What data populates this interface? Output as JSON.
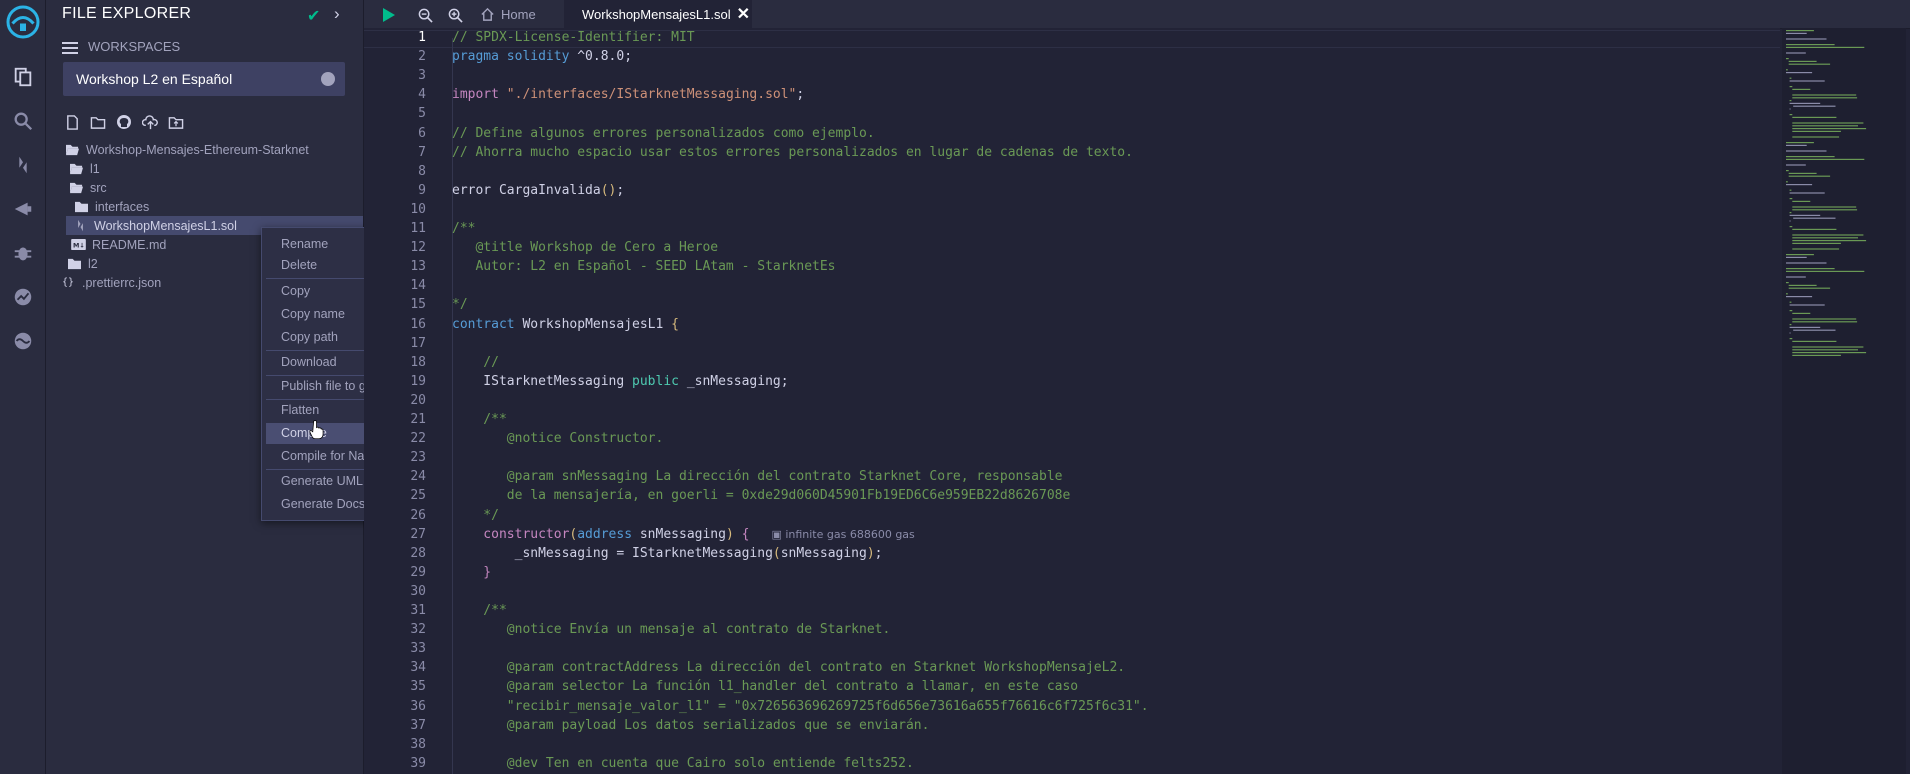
{
  "colors": {
    "accent": "#00bc8c",
    "sidebar_bg": "#2a2c3f",
    "editor_bg": "#222336",
    "menu_highlight": "#4a4e72"
  },
  "icon_bar": [
    "remix-logo-icon",
    "file-explorer-icon",
    "search-icon",
    "solidity-compiler-icon",
    "deploy-run-icon",
    "debugger-icon",
    "analytics-icon",
    "plugin-icon"
  ],
  "panel": {
    "title": "FILE EXPLORER",
    "workspaces_label": "WORKSPACES",
    "workspace_selected": "Workshop L2 en Español",
    "toolbar_icons": [
      "new-file-icon",
      "new-folder-icon",
      "github-icon",
      "upload-icon",
      "upload-folder-icon"
    ]
  },
  "tree": [
    {
      "label": "Workshop-Mensajes-Ethereum-Starknet",
      "icon": "folder-open-icon"
    },
    {
      "label": "l1",
      "icon": "folder-open-icon"
    },
    {
      "label": "src",
      "icon": "folder-open-icon"
    },
    {
      "label": "interfaces",
      "icon": "folder-icon"
    },
    {
      "label": "WorkshopMensajesL1.sol",
      "icon": "solidity-file-icon"
    },
    {
      "label": "README.md",
      "icon": "markdown-icon"
    },
    {
      "label": "l2",
      "icon": "folder-icon"
    },
    {
      "label": ".prettierrc.json",
      "icon": "json-icon"
    }
  ],
  "context_menu": {
    "items": [
      "Rename",
      "Delete",
      "Copy",
      "Copy name",
      "Copy path",
      "Download",
      "Publish file to gist",
      "Flatten",
      "Compile",
      "Compile for Nahmii",
      "Generate UML",
      "Generate Docs"
    ],
    "highlighted": "Compile"
  },
  "tabs": {
    "home": "Home",
    "active": "WorkshopMensajesL1.sol"
  },
  "editor": {
    "line_numbers": [
      "1",
      "2",
      "3",
      "4",
      "5",
      "6",
      "7",
      "8",
      "9",
      "10",
      "11",
      "12",
      "13",
      "14",
      "15",
      "16",
      "17",
      "18",
      "19",
      "20",
      "21",
      "22",
      "23",
      "24",
      "25",
      "26",
      "27",
      "28",
      "29",
      "30",
      "31",
      "32",
      "33",
      "34",
      "35",
      "36",
      "37",
      "38",
      "39"
    ],
    "gas_hint": "infinite gas 688600 gas",
    "lines": [
      [
        [
          "com",
          "// SPDX-License-Identifier: MIT"
        ]
      ],
      [
        [
          "kw",
          "pragma solidity "
        ],
        [
          "pun",
          "^0.8.0;"
        ]
      ],
      [],
      [
        [
          "kw2",
          "import "
        ],
        [
          "str",
          "\"./interfaces/IStarknetMessaging.sol\""
        ],
        [
          "pun",
          ";"
        ]
      ],
      [],
      [
        [
          "com",
          "// Define algunos errores personalizados como ejemplo."
        ]
      ],
      [
        [
          "com",
          "// Ahorra mucho espacio usar estos errores personalizados en lugar de cadenas de texto."
        ]
      ],
      [],
      [
        [
          "pun",
          "error CargaInvalida"
        ],
        [
          "br",
          "()"
        ],
        [
          "pun",
          ";"
        ]
      ],
      [],
      [
        [
          "com",
          "/**"
        ]
      ],
      [
        [
          "com",
          "   @title Workshop de Cero a Heroe"
        ]
      ],
      [
        [
          "com",
          "   Autor: L2 en Español - SEED LAtam - StarknetEs"
        ]
      ],
      [],
      [
        [
          "com",
          "*/"
        ]
      ],
      [
        [
          "kw",
          "contract "
        ],
        [
          "pun",
          "WorkshopMensajesL1 "
        ],
        [
          "br",
          "{"
        ]
      ],
      [],
      [
        [
          "com",
          "    //"
        ]
      ],
      [
        [
          "pun",
          "    IStarknetMessaging "
        ],
        [
          "type",
          "public "
        ],
        [
          "pun",
          "_snMessaging;"
        ]
      ],
      [],
      [
        [
          "com",
          "    /**"
        ]
      ],
      [
        [
          "com",
          "       @notice Constructor."
        ]
      ],
      [],
      [
        [
          "com",
          "       @param snMessaging La dirección del contrato Starknet Core, responsable"
        ]
      ],
      [
        [
          "com",
          "       de la mensajería, en goerli = 0xde29d060D45901Fb19ED6C6e959EB22d8626708e"
        ]
      ],
      [
        [
          "com",
          "    */"
        ]
      ],
      [
        [
          "kw2",
          "    constructor"
        ],
        [
          "br",
          "("
        ],
        [
          "kw",
          "address "
        ],
        [
          "pun",
          "snMessaging"
        ],
        [
          "br",
          ")"
        ],
        [
          "pun",
          " "
        ],
        [
          "kw2",
          "{"
        ],
        [
          "gas",
          "GAS"
        ]
      ],
      [
        [
          "pun",
          "        _snMessaging = IStarknetMessaging"
        ],
        [
          "br",
          "("
        ],
        [
          "pun",
          "snMessaging"
        ],
        [
          "br",
          ")"
        ],
        [
          "pun",
          ";"
        ]
      ],
      [
        [
          "kw2",
          "    }"
        ]
      ],
      [],
      [
        [
          "com",
          "    /**"
        ]
      ],
      [
        [
          "com",
          "       @notice Envía un mensaje al contrato de Starknet."
        ]
      ],
      [],
      [
        [
          "com",
          "       @param contractAddress La dirección del contrato en Starknet WorkshopMensajeL2."
        ]
      ],
      [
        [
          "com",
          "       @param selector La función l1_handler del contrato a llamar, en este caso"
        ]
      ],
      [
        [
          "com",
          "       \"recibir_mensaje_valor_l1\" = \"0x726563696269725f6d656e73616a655f76616c6f725f6c31\"."
        ]
      ],
      [
        [
          "com",
          "       @param payload Los datos serializados que se enviarán."
        ]
      ],
      [],
      [
        [
          "com",
          "       @dev Ten en cuenta que Cairo solo entiende felts252."
        ]
      ]
    ]
  }
}
